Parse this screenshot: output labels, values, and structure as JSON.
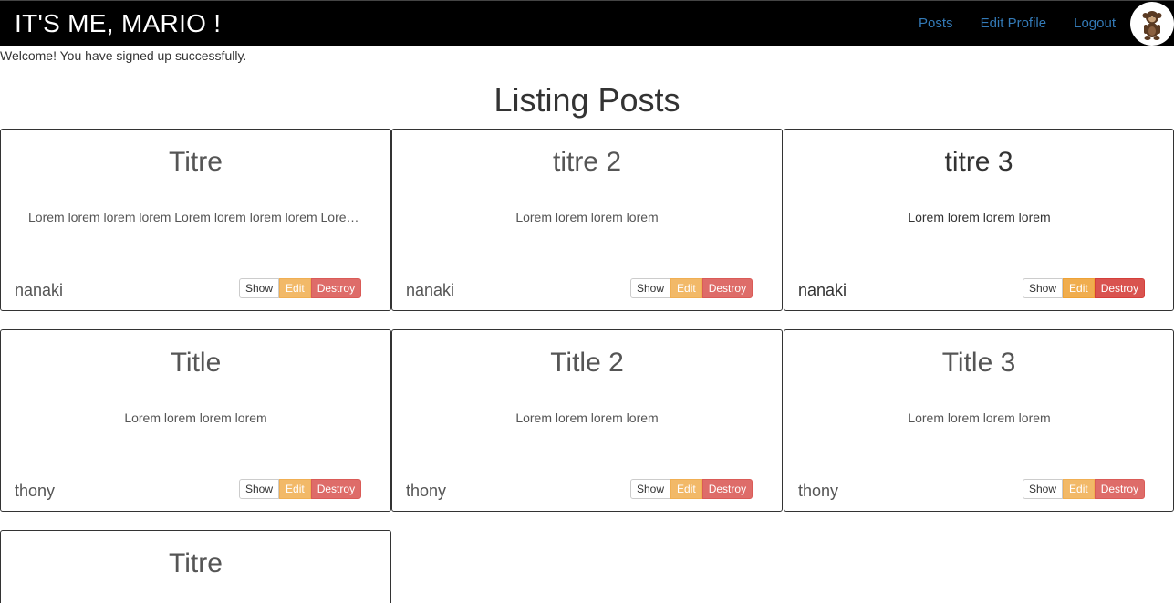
{
  "nav": {
    "brand": "IT'S ME, MARIO !",
    "links": [
      "Posts",
      "Edit Profile",
      "Logout"
    ],
    "avatar_icon": "monkey-avatar-icon"
  },
  "flash": "Welcome! You have signed up successfully.",
  "page_title": "Listing Posts",
  "buttons": {
    "show": "Show",
    "edit": "Edit",
    "destroy": "Destroy"
  },
  "posts": [
    {
      "title": "Titre",
      "body": "Lorem lorem lorem lorem Lorem lorem lorem lorem Lorem lorem lorem lorem",
      "author": "nanaki"
    },
    {
      "title": "titre 2",
      "body": "Lorem lorem lorem lorem",
      "author": "nanaki"
    },
    {
      "title": "titre 3",
      "body": "Lorem lorem lorem lorem",
      "author": "nanaki"
    },
    {
      "title": "Title",
      "body": "Lorem lorem lorem lorem",
      "author": "thony"
    },
    {
      "title": "Title 2",
      "body": "Lorem lorem lorem lorem",
      "author": "thony"
    },
    {
      "title": "Title 3",
      "body": "Lorem lorem lorem lorem",
      "author": "thony"
    },
    {
      "title": "Titre",
      "body": "",
      "author": ""
    }
  ],
  "colors": {
    "navbar": "#000000",
    "link": "#337ab7",
    "edit": "#f0ad4e",
    "destroy": "#d9534f"
  }
}
